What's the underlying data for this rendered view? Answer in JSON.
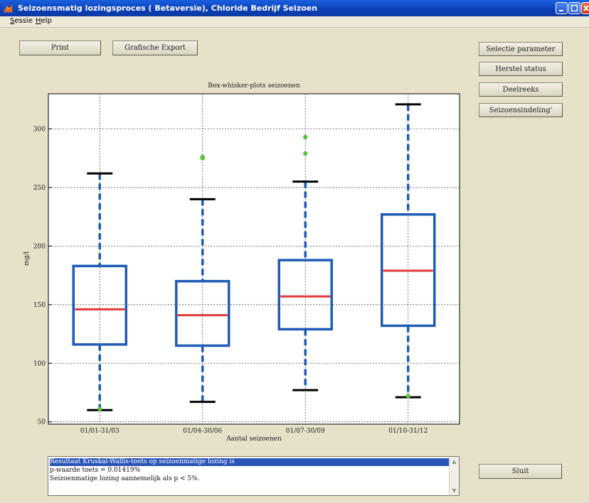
{
  "window": {
    "title": "Seizoensmatig lozingsproces ( Betaversie), Chloride Bedrijf Seizoen"
  },
  "menu": [
    {
      "label": "Sessie",
      "accel": "S",
      "rest": "essie"
    },
    {
      "label": "Help",
      "accel": "H",
      "rest": "elp"
    }
  ],
  "toolbar": {
    "print_label": "Print",
    "export_label": "Grafische Export"
  },
  "side_buttons": {
    "selectie": "Selectie parameter",
    "herstel": "Herstel status",
    "deelreeks": "Deelreeks",
    "seizoen": "Seizoensindeling'",
    "sluit": "Sluit"
  },
  "messages": [
    "Resultaat Kruskal-Wallis-toets op seizoenmatige lozing is",
    "p-waarde toets = 0.01419%",
    "Seizoenmatige lozing aannemelijk als p < 5%."
  ],
  "chart_data": {
    "type": "boxplot",
    "title": "Box-whisker-plots seizoenen",
    "xlabel": "Aantal seizoenen",
    "ylabel": "mg/l",
    "ylim": [
      48,
      330
    ],
    "yticks": [
      50,
      100,
      150,
      200,
      250,
      300
    ],
    "grid": true,
    "categories": [
      "01/01-31/03",
      "01/04-30/06",
      "01/07-30/09",
      "01/10-31/12"
    ],
    "boxes": [
      {
        "whisker_low": 60,
        "q1": 116,
        "median": 146,
        "q3": 183,
        "whisker_high": 262,
        "outliers": [
          61
        ]
      },
      {
        "whisker_low": 67,
        "q1": 115,
        "median": 141,
        "q3": 170,
        "whisker_high": 240,
        "outliers": [
          275,
          276
        ]
      },
      {
        "whisker_low": 77,
        "q1": 129,
        "median": 157,
        "q3": 188,
        "whisker_high": 255,
        "outliers": [
          279,
          293
        ]
      },
      {
        "whisker_low": 71,
        "q1": 132,
        "median": 179,
        "q3": 227,
        "whisker_high": 321,
        "outliers": [
          72
        ]
      }
    ],
    "colors": {
      "box": "#1f5cb5",
      "median": "#e23a3a",
      "whisker_cap": "#000000",
      "outlier": "#5dc23a"
    }
  }
}
